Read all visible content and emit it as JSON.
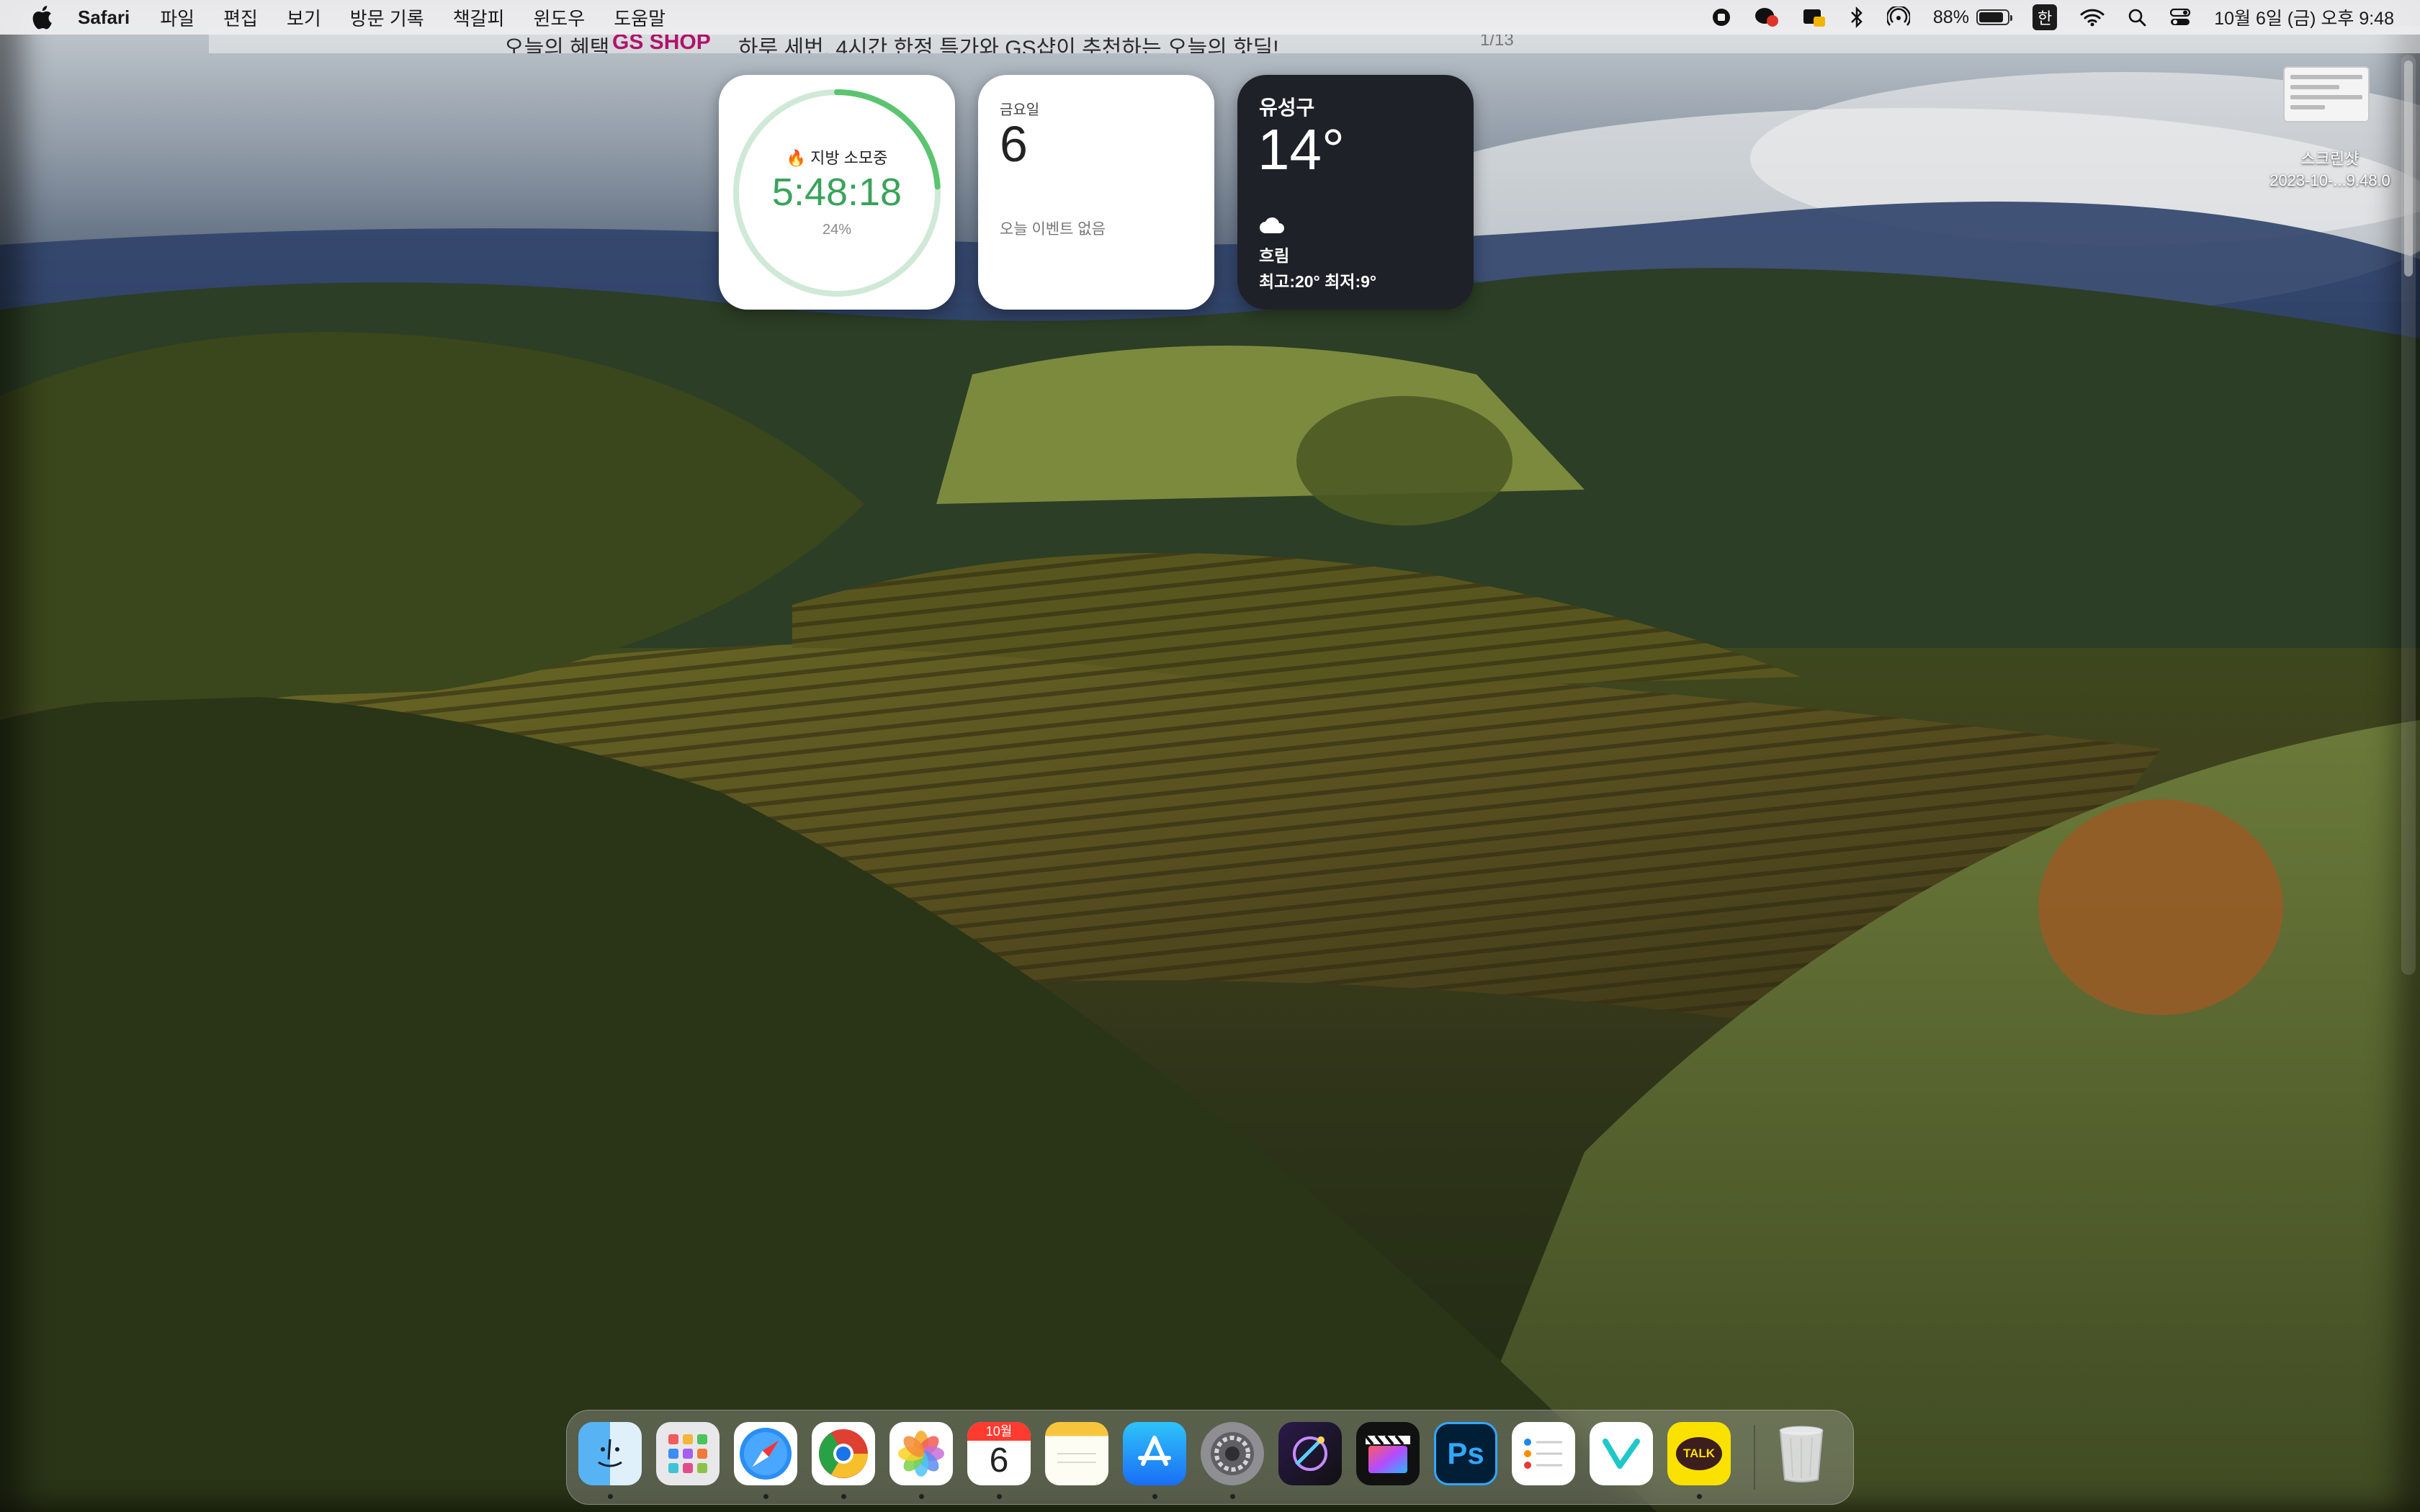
{
  "menubar": {
    "app_name": "Safari",
    "items": [
      "파일",
      "편집",
      "보기",
      "방문 기록",
      "책갈피",
      "윈도우",
      "도움말"
    ],
    "status": {
      "battery_percent": "88%",
      "battery_level": 0.88,
      "input_source": "한",
      "clock": "10월 6일 (금) 오후 9:48"
    },
    "icons": [
      "apple-icon",
      "record-icon",
      "messenger-icon",
      "ai-icon",
      "bluetooth-icon",
      "airdrop-icon",
      "wifi-icon",
      "search-icon",
      "control-center-icon"
    ]
  },
  "ghost_strip": {
    "left_text": "오늘의 혜택",
    "brand": "GS SHOP",
    "promo": "하루 세번, 4시간 한정 특가와 GS샵이 추천하는 오늘의 핫딜!",
    "counter": "1/13"
  },
  "widgets": {
    "fitness": {
      "title": "지방 소모중",
      "time": "5:48:18",
      "percent": "24%",
      "progress": 0.24
    },
    "calendar": {
      "weekday": "금요일",
      "date": "6",
      "empty_text": "오늘 이벤트 없음"
    },
    "weather": {
      "location": "유성구",
      "temperature": "14°",
      "condition": "흐림",
      "range": "최고:20° 최저:9°"
    }
  },
  "desktop": {
    "file_label_line1": "스크린샷",
    "file_label_line2": "2023-10-...9.48.0"
  },
  "dock": {
    "apps": [
      {
        "name": "Finder",
        "running": true
      },
      {
        "name": "Launchpad",
        "running": false
      },
      {
        "name": "Safari",
        "running": true
      },
      {
        "name": "Chrome",
        "running": true
      },
      {
        "name": "Photos",
        "running": true
      },
      {
        "name": "Calendar",
        "running": true,
        "month": "10월",
        "day": "6"
      },
      {
        "name": "Notes",
        "running": false
      },
      {
        "name": "App Store",
        "running": true
      },
      {
        "name": "System Settings",
        "running": true
      },
      {
        "name": "Motion",
        "running": false
      },
      {
        "name": "Final Cut Pro",
        "running": false
      },
      {
        "name": "Photoshop",
        "running": false,
        "label": "Ps"
      },
      {
        "name": "Reminders",
        "running": false
      },
      {
        "name": "Vita",
        "running": false
      },
      {
        "name": "KakaoTalk",
        "running": true,
        "label": "TALK"
      },
      {
        "name": "Trash",
        "running": false
      }
    ]
  }
}
